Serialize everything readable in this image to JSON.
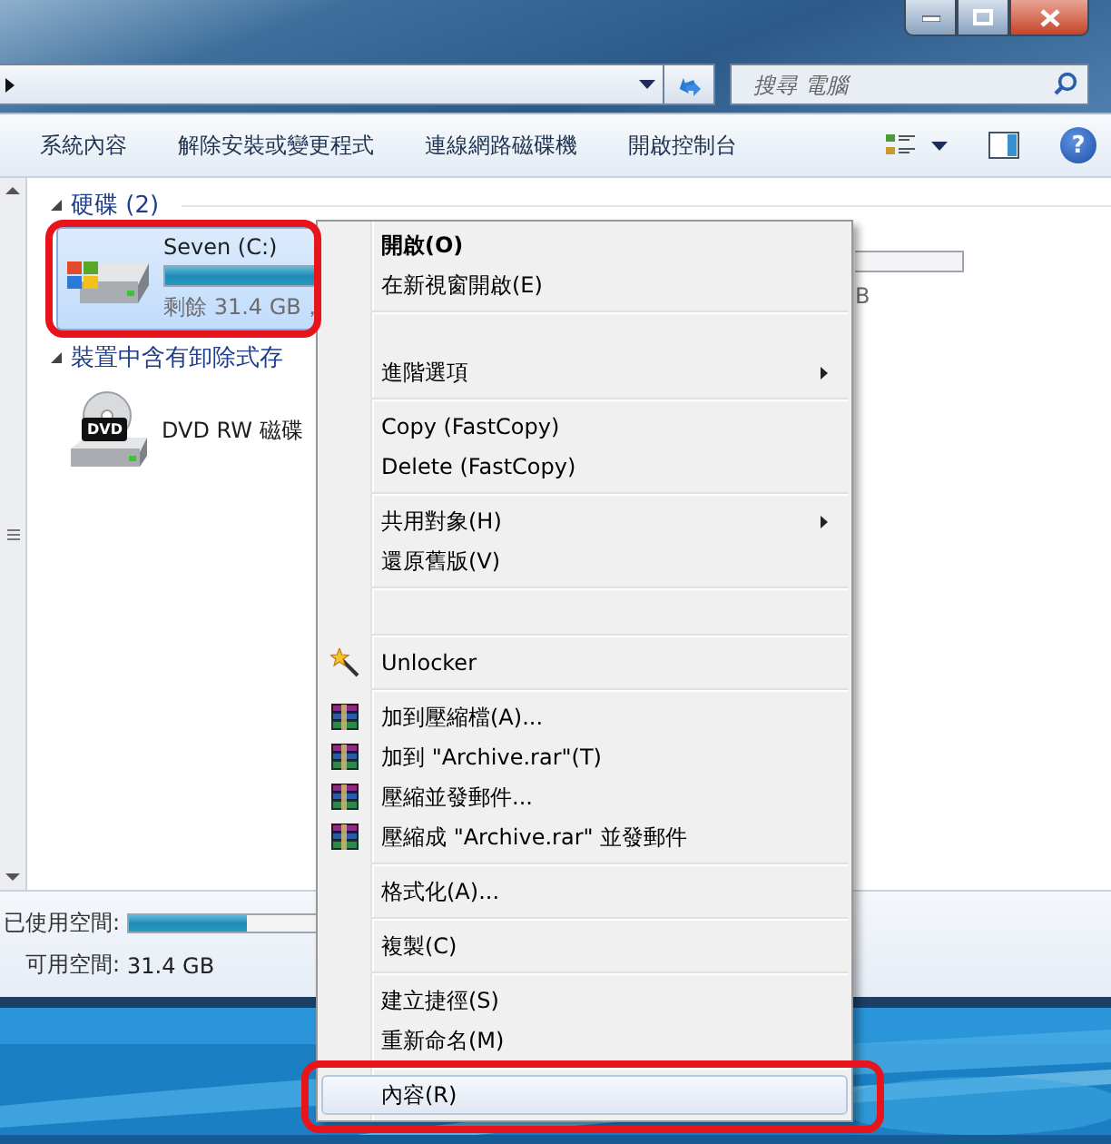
{
  "search": {
    "placeholder": "搜尋 電腦"
  },
  "toolbar": {
    "buttons": [
      "系統內容",
      "解除安裝或變更程式",
      "連線網路磁碟機",
      "開啟控制台"
    ],
    "help": "?"
  },
  "groups": [
    {
      "title": "硬碟 (2)",
      "expanded": true,
      "drives": [
        {
          "kind": "hdd",
          "name": "Seven (C:)",
          "level": 1,
          "free": "剩餘 31.4 GB，",
          "selected": true,
          "highlighted": true
        },
        {
          "kind": "partial",
          "free": "B",
          "selected": false,
          "highlighted": false
        }
      ]
    },
    {
      "title": "裝置中含有卸除式存",
      "expanded": true,
      "drives": [
        {
          "kind": "dvd",
          "name": "DVD RW 磁碟",
          "icon_label": "DVD",
          "selected": false,
          "highlighted": false
        }
      ]
    }
  ],
  "details": {
    "used": {
      "label": "已使用空間:",
      "level": 0.6
    },
    "free": {
      "label": "可用空間:",
      "value": "31.4 GB"
    }
  },
  "context_menu": {
    "items": [
      {
        "kind": "item",
        "label": "開啟(O)",
        "default": true,
        "submenu": false,
        "selected": false,
        "highlighted": false
      },
      {
        "kind": "item",
        "label": "在新視窗開啟(E)",
        "default": false,
        "submenu": false,
        "selected": false,
        "highlighted": false
      },
      {
        "kind": "separator"
      },
      {
        "kind": "blank"
      },
      {
        "kind": "item",
        "label": "進階選項",
        "default": false,
        "submenu": true,
        "selected": false,
        "highlighted": false
      },
      {
        "kind": "separator"
      },
      {
        "kind": "item",
        "label": "Copy  (FastCopy)",
        "default": false,
        "submenu": false,
        "selected": false,
        "highlighted": false
      },
      {
        "kind": "item",
        "label": "Delete (FastCopy)",
        "default": false,
        "submenu": false,
        "selected": false,
        "highlighted": false
      },
      {
        "kind": "separator"
      },
      {
        "kind": "item",
        "label": "共用對象(H)",
        "default": false,
        "submenu": true,
        "selected": false,
        "highlighted": false
      },
      {
        "kind": "item",
        "label": "還原舊版(V)",
        "default": false,
        "submenu": false,
        "selected": false,
        "highlighted": false
      },
      {
        "kind": "separator"
      },
      {
        "kind": "blank"
      },
      {
        "kind": "separator"
      },
      {
        "kind": "tool",
        "label": "Unlocker",
        "default": false,
        "submenu": false,
        "selected": false,
        "highlighted": false
      },
      {
        "kind": "separator"
      },
      {
        "kind": "archive",
        "label": "加到壓縮檔(A)...",
        "default": false,
        "submenu": false,
        "selected": false,
        "highlighted": false
      },
      {
        "kind": "archive",
        "label": "加到 \"Archive.rar\"(T)",
        "default": false,
        "submenu": false,
        "selected": false,
        "highlighted": false
      },
      {
        "kind": "archive",
        "label": "壓縮並發郵件...",
        "default": false,
        "submenu": false,
        "selected": false,
        "highlighted": false
      },
      {
        "kind": "archive",
        "label": "壓縮成 \"Archive.rar\" 並發郵件",
        "default": false,
        "submenu": false,
        "selected": false,
        "highlighted": false
      },
      {
        "kind": "separator"
      },
      {
        "kind": "item",
        "label": "格式化(A)...",
        "default": false,
        "submenu": false,
        "selected": false,
        "highlighted": false
      },
      {
        "kind": "separator"
      },
      {
        "kind": "item",
        "label": "複製(C)",
        "default": false,
        "submenu": false,
        "selected": false,
        "highlighted": false
      },
      {
        "kind": "separator"
      },
      {
        "kind": "item",
        "label": "建立捷徑(S)",
        "default": false,
        "submenu": false,
        "selected": false,
        "highlighted": false
      },
      {
        "kind": "item",
        "label": "重新命名(M)",
        "default": false,
        "submenu": false,
        "selected": false,
        "highlighted": false
      },
      {
        "kind": "separator"
      },
      {
        "kind": "item",
        "label": "內容(R)",
        "default": false,
        "submenu": false,
        "selected": true,
        "highlighted": true
      }
    ]
  }
}
